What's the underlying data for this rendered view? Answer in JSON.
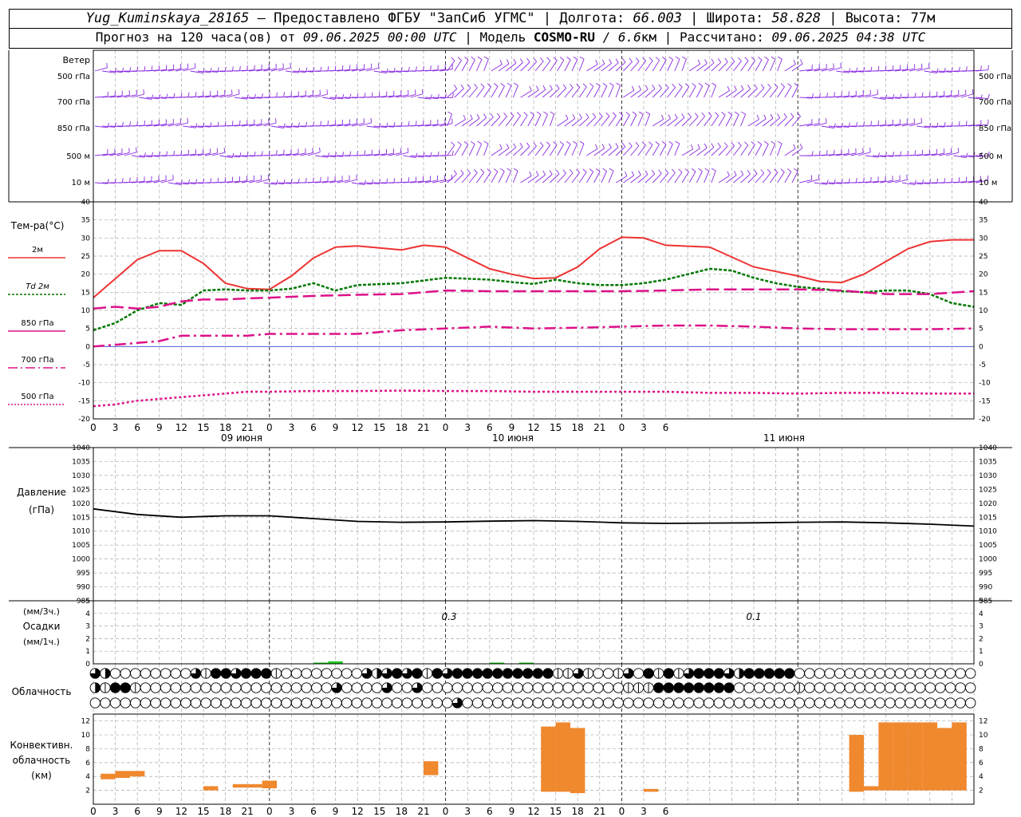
{
  "header": {
    "station": "Yug_Kuminskaya_28165",
    "dash": "—",
    "provided_by": "Предоставлено ФГБУ \"ЗапСиб УГМС\"",
    "lon_label": "Долгота:",
    "lon_value": "66.003",
    "lat_label": "Широта:",
    "lat_value": "58.828",
    "alt_label": "Высота:",
    "alt_value": "77м",
    "forecast_label": "Прогноз на 120 часа(ов) от",
    "forecast_date": "09.06.2025 00:00 UTC",
    "model_label": "| Модель",
    "model_name": "COSMO-RU",
    "model_res": "/ 6.6",
    "model_res_unit": "км",
    "calc_label": "| Рассчитано:",
    "calc_date": "09.06.2025 04:38 UTC"
  },
  "colors": {
    "wind": "#8a2be2",
    "t2m": "#ee3333",
    "td2m": "#007700",
    "t850": "#dd1188",
    "t700": "#dd1188",
    "t500": "#dd1188",
    "pressure": "#000000",
    "precip": "#22cc22",
    "convective": "#f0882e",
    "zero_line": "#3344cc"
  },
  "x_axis": {
    "hour_ticks": [
      "0",
      "3",
      "6",
      "9",
      "12",
      "15",
      "18",
      "21",
      "0",
      "3",
      "6",
      "9",
      "12",
      "15",
      "18",
      "21",
      "0",
      "3",
      "6",
      "9",
      "12",
      "15",
      "18",
      "21",
      "0",
      "3",
      "6"
    ],
    "day_labels": [
      "09 июня",
      "10 июня",
      "11 июня"
    ]
  },
  "wind_panel": {
    "title": "Ветер",
    "levels": [
      "500 гПа",
      "700 гПа",
      "850 гПа",
      "500  м",
      "10  м"
    ]
  },
  "temp_panel": {
    "title": "Тем-ра(°C)",
    "legend": [
      "2м",
      "Td  2м",
      "850 гПа",
      "700 гПа",
      "500 гПа"
    ],
    "yticks": [
      "40",
      "35",
      "30",
      "25",
      "20",
      "15",
      "10",
      "5",
      "0",
      "-5",
      "-10",
      "-15",
      "-20"
    ]
  },
  "pressure_panel": {
    "title1": "Давление",
    "title2": "(гПа)",
    "yticks": [
      "1040",
      "1035",
      "1030",
      "1025",
      "1020",
      "1015",
      "1010",
      "1005",
      "1000",
      "995",
      "990",
      "985"
    ]
  },
  "precip_panel": {
    "title1": "(мм/3ч.)",
    "title2": "Осадки",
    "title3": "(мм/1ч.)",
    "yticks": [
      "5",
      "4",
      "3",
      "2",
      "1",
      "0"
    ],
    "totals": [
      "0.3",
      "0.1"
    ]
  },
  "cloud_panel": {
    "title": "Облачность"
  },
  "conv_panel": {
    "title1": "Конвективн.",
    "title2": "облачность",
    "title3": "(км)",
    "yticks": [
      "12",
      "10",
      "8",
      "6",
      "4",
      "2"
    ]
  },
  "chart_data": {
    "type": "line",
    "x_unit": "hours since 09.06.2025 00:00 UTC",
    "temperature": {
      "ylim": [
        -20,
        40
      ],
      "series": [
        {
          "name": "2м",
          "x": [
            0,
            6,
            9,
            12,
            15,
            18,
            21,
            24,
            27,
            30,
            33,
            36,
            42,
            45,
            48,
            51,
            54,
            57,
            60,
            63,
            66,
            69,
            72,
            75,
            78,
            84,
            90,
            96,
            99,
            102,
            105,
            108,
            111,
            114,
            117,
            120
          ],
          "values": [
            13.5,
            24,
            26.5,
            26.5,
            23,
            17.5,
            16,
            15.8,
            19.5,
            24.5,
            27.5,
            27.8,
            26.7,
            28,
            27.5,
            24.5,
            21.5,
            20,
            18.8,
            19,
            22,
            27,
            30.2,
            30,
            28,
            27.5,
            22,
            19.5,
            18,
            17.7,
            20,
            23.5,
            27,
            29,
            29.5,
            29.5
          ]
        },
        {
          "name": "Td  2м",
          "x": [
            0,
            3,
            6,
            9,
            12,
            15,
            18,
            21,
            24,
            27,
            30,
            33,
            36,
            42,
            48,
            54,
            57,
            60,
            63,
            66,
            69,
            72,
            75,
            78,
            81,
            84,
            87,
            90,
            93,
            96,
            99,
            102,
            105,
            108,
            111,
            114,
            117,
            120
          ],
          "values": [
            4.5,
            6.5,
            10,
            12,
            11.5,
            15.5,
            15.8,
            15.5,
            15.5,
            16,
            17.5,
            15.5,
            17,
            17.5,
            19,
            18.5,
            17.8,
            17.3,
            18.5,
            17.5,
            17,
            17,
            17.5,
            18.5,
            20,
            21.5,
            21,
            19,
            17.5,
            16.5,
            16,
            15.3,
            15,
            15.5,
            15.5,
            14.5,
            12,
            11
          ]
        },
        {
          "name": "850 гПа",
          "x": [
            0,
            3,
            6,
            9,
            12,
            15,
            18,
            21,
            24,
            30,
            36,
            42,
            48,
            54,
            60,
            66,
            72,
            78,
            84,
            90,
            96,
            102,
            108,
            114,
            120
          ],
          "values": [
            10.5,
            11,
            10.5,
            11,
            12.5,
            13,
            13,
            13.3,
            13.5,
            14,
            14.3,
            14.5,
            15.5,
            15.3,
            15.3,
            15.3,
            15.3,
            15.5,
            15.8,
            15.8,
            15.8,
            15.5,
            14.5,
            14.5,
            15.3
          ]
        },
        {
          "name": "700 гПа",
          "x": [
            0,
            3,
            6,
            9,
            12,
            15,
            18,
            21,
            24,
            30,
            36,
            42,
            48,
            54,
            60,
            66,
            72,
            78,
            84,
            90,
            96,
            102,
            108,
            114,
            120
          ],
          "values": [
            0,
            0.5,
            1,
            1.5,
            3,
            3,
            3,
            3,
            3.5,
            3.5,
            3.5,
            4.5,
            5,
            5.5,
            5,
            5.2,
            5.5,
            5.8,
            5.8,
            5.5,
            5,
            4.8,
            4.8,
            4.8,
            5
          ]
        },
        {
          "name": "500 гПа",
          "x": [
            0,
            3,
            6,
            9,
            12,
            15,
            18,
            21,
            24,
            30,
            36,
            42,
            48,
            54,
            60,
            66,
            72,
            78,
            84,
            90,
            96,
            102,
            108,
            114,
            120
          ],
          "values": [
            -16.5,
            -16,
            -15,
            -14.5,
            -14,
            -13.5,
            -13,
            -12.5,
            -12.5,
            -12.3,
            -12.3,
            -12.2,
            -12.3,
            -12.3,
            -12.5,
            -12.5,
            -12.5,
            -12.5,
            -12.8,
            -12.8,
            -13,
            -12.8,
            -12.8,
            -13,
            -13
          ]
        }
      ]
    },
    "pressure": {
      "ylim": [
        985,
        1040
      ],
      "x": [
        0,
        6,
        12,
        18,
        24,
        30,
        36,
        42,
        48,
        54,
        60,
        66,
        72,
        78,
        84,
        90,
        96,
        102,
        108,
        114,
        120
      ],
      "values": [
        1018,
        1016,
        1015,
        1015.5,
        1015.5,
        1014.5,
        1013.5,
        1013.2,
        1013.3,
        1013.6,
        1013.8,
        1013.5,
        1013,
        1012.8,
        1012.9,
        1013,
        1013.2,
        1013.3,
        1013,
        1012.5,
        1011.8
      ]
    },
    "precipitation": {
      "ylim": [
        0,
        5
      ],
      "bars": [
        {
          "x_start": 15,
          "x_end": 16,
          "value": 0.1
        },
        {
          "x_start": 16,
          "x_end": 17,
          "value": 0.2
        },
        {
          "x_start": 27,
          "x_end": 28,
          "value": 0.1
        },
        {
          "x_start": 29,
          "x_end": 30,
          "value": 0.1
        }
      ],
      "totals": [
        "0.3",
        "0.1"
      ]
    },
    "cloud_cover": {
      "rows": [
        "upper",
        "middle",
        "lower"
      ],
      "values_per_step": "0 = clear, 1 = quarter, 2 = half, 3 = three-quarter, 4 = overcast",
      "upper": [
        3,
        2,
        0,
        0,
        0,
        0,
        0,
        0,
        0,
        0,
        3,
        1,
        4,
        4,
        3,
        4,
        4,
        4,
        1,
        0,
        0,
        0,
        0,
        0,
        0,
        0,
        0,
        3,
        2,
        3,
        4,
        3,
        4,
        1,
        4,
        3,
        4,
        4,
        4,
        4,
        4,
        4,
        4,
        4,
        4,
        4,
        1,
        1,
        3,
        1,
        0,
        0,
        1,
        3,
        0,
        4,
        1,
        4,
        1,
        3,
        4,
        4,
        4,
        3,
        2,
        4,
        4,
        4,
        4,
        4,
        0,
        0,
        0,
        0,
        0,
        0,
        0,
        0,
        0,
        0,
        0,
        0,
        0,
        0,
        0,
        0,
        0,
        0,
        0,
        0,
        0,
        0,
        0,
        0,
        0,
        0,
        0,
        0,
        0,
        0,
        0,
        0,
        0,
        0,
        0,
        0,
        0,
        0,
        0,
        0,
        0,
        0,
        0,
        0,
        0,
        0,
        0,
        0,
        0,
        3,
        2
      ],
      "middle": [
        2,
        1,
        4,
        4,
        1,
        0,
        0,
        0,
        0,
        0,
        0,
        0,
        0,
        0,
        0,
        0,
        0,
        0,
        0,
        0,
        0,
        0,
        0,
        0,
        3,
        0,
        0,
        0,
        0,
        3,
        0,
        0,
        3,
        0,
        0,
        0,
        0,
        0,
        0,
        0,
        0,
        0,
        0,
        0,
        0,
        0,
        0,
        0,
        0,
        0,
        0,
        0,
        0,
        1,
        1,
        1,
        4,
        4,
        4,
        4,
        4,
        4,
        4,
        4,
        0,
        0,
        0,
        0,
        0,
        0,
        1,
        0,
        0,
        0,
        0,
        0,
        0,
        0,
        0,
        0,
        0,
        0,
        0,
        0,
        0,
        0,
        0,
        0,
        0,
        0,
        0,
        0,
        0,
        0,
        0,
        0,
        0,
        0,
        0,
        0,
        0,
        0,
        0,
        0,
        0,
        0,
        0,
        1,
        0,
        0,
        0,
        0,
        0,
        0,
        0,
        0,
        0,
        0,
        0,
        0,
        0,
        0,
        0,
        0,
        0,
        0,
        0,
        0,
        0,
        0,
        0,
        2,
        3
      ],
      "lower": [
        0,
        0,
        0,
        0,
        0,
        0,
        0,
        0,
        0,
        0,
        0,
        0,
        0,
        0,
        0,
        0,
        0,
        0,
        0,
        0,
        0,
        0,
        0,
        0,
        0,
        0,
        0,
        0,
        0,
        0,
        0,
        0,
        0,
        0,
        0,
        0,
        3,
        0,
        0,
        0,
        0,
        0,
        0,
        0,
        0,
        0,
        0,
        0,
        0,
        0,
        0,
        0,
        0,
        0,
        0,
        0,
        0,
        0,
        0,
        0,
        0,
        0,
        0,
        0,
        0,
        0,
        0,
        0,
        0,
        0,
        0,
        0,
        0,
        0,
        0,
        0,
        0,
        0,
        0,
        0,
        0,
        0,
        0,
        0,
        0,
        0,
        0,
        0,
        0,
        0,
        0,
        0,
        0,
        0,
        0,
        0,
        3,
        0,
        0,
        0,
        0,
        0,
        0,
        0,
        0,
        0,
        0,
        0,
        0,
        0,
        0,
        0,
        0,
        0,
        0,
        0,
        0,
        0,
        0,
        0,
        0,
        0,
        0,
        0
      ]
    },
    "convective_cloud": {
      "ylim": [
        0,
        13
      ],
      "unit": "km",
      "bars": [
        {
          "x_start": 0.5,
          "x_end": 1.5,
          "base": 3.6,
          "top": 4.4
        },
        {
          "x_start": 1.5,
          "x_end": 2.5,
          "base": 3.8,
          "top": 4.8
        },
        {
          "x_start": 2.5,
          "x_end": 3.5,
          "base": 4.0,
          "top": 4.8
        },
        {
          "x_start": 7.5,
          "x_end": 8.5,
          "base": 2.0,
          "top": 2.6
        },
        {
          "x_start": 9.5,
          "x_end": 10.5,
          "base": 2.4,
          "top": 2.9
        },
        {
          "x_start": 10.5,
          "x_end": 11.5,
          "base": 2.4,
          "top": 2.9
        },
        {
          "x_start": 11.5,
          "x_end": 12.5,
          "base": 2.3,
          "top": 3.4
        },
        {
          "x_start": 22.5,
          "x_end": 23.5,
          "base": 4.2,
          "top": 6.2
        },
        {
          "x_start": 30.5,
          "x_end": 31.5,
          "base": 1.8,
          "top": 11.2
        },
        {
          "x_start": 31.5,
          "x_end": 32.5,
          "base": 1.8,
          "top": 11.8
        },
        {
          "x_start": 32.5,
          "x_end": 33.5,
          "base": 1.6,
          "top": 11.0
        },
        {
          "x_start": 37.5,
          "x_end": 38.5,
          "base": 1.8,
          "top": 2.2
        },
        {
          "x_start": 51.5,
          "x_end": 52.5,
          "base": 1.8,
          "top": 10.0
        },
        {
          "x_start": 52.5,
          "x_end": 53.5,
          "base": 2.0,
          "top": 2.6
        },
        {
          "x_start": 53.5,
          "x_end": 54.5,
          "base": 2.0,
          "top": 11.8
        },
        {
          "x_start": 54.5,
          "x_end": 55.5,
          "base": 2.0,
          "top": 11.8
        },
        {
          "x_start": 55.5,
          "x_end": 56.5,
          "base": 2.0,
          "top": 11.8
        },
        {
          "x_start": 56.5,
          "x_end": 57.5,
          "base": 2.0,
          "top": 11.8
        },
        {
          "x_start": 57.5,
          "x_end": 58.5,
          "base": 2.0,
          "top": 11.0
        },
        {
          "x_start": 58.5,
          "x_end": 59.5,
          "base": 2.0,
          "top": 11.8
        }
      ]
    }
  }
}
